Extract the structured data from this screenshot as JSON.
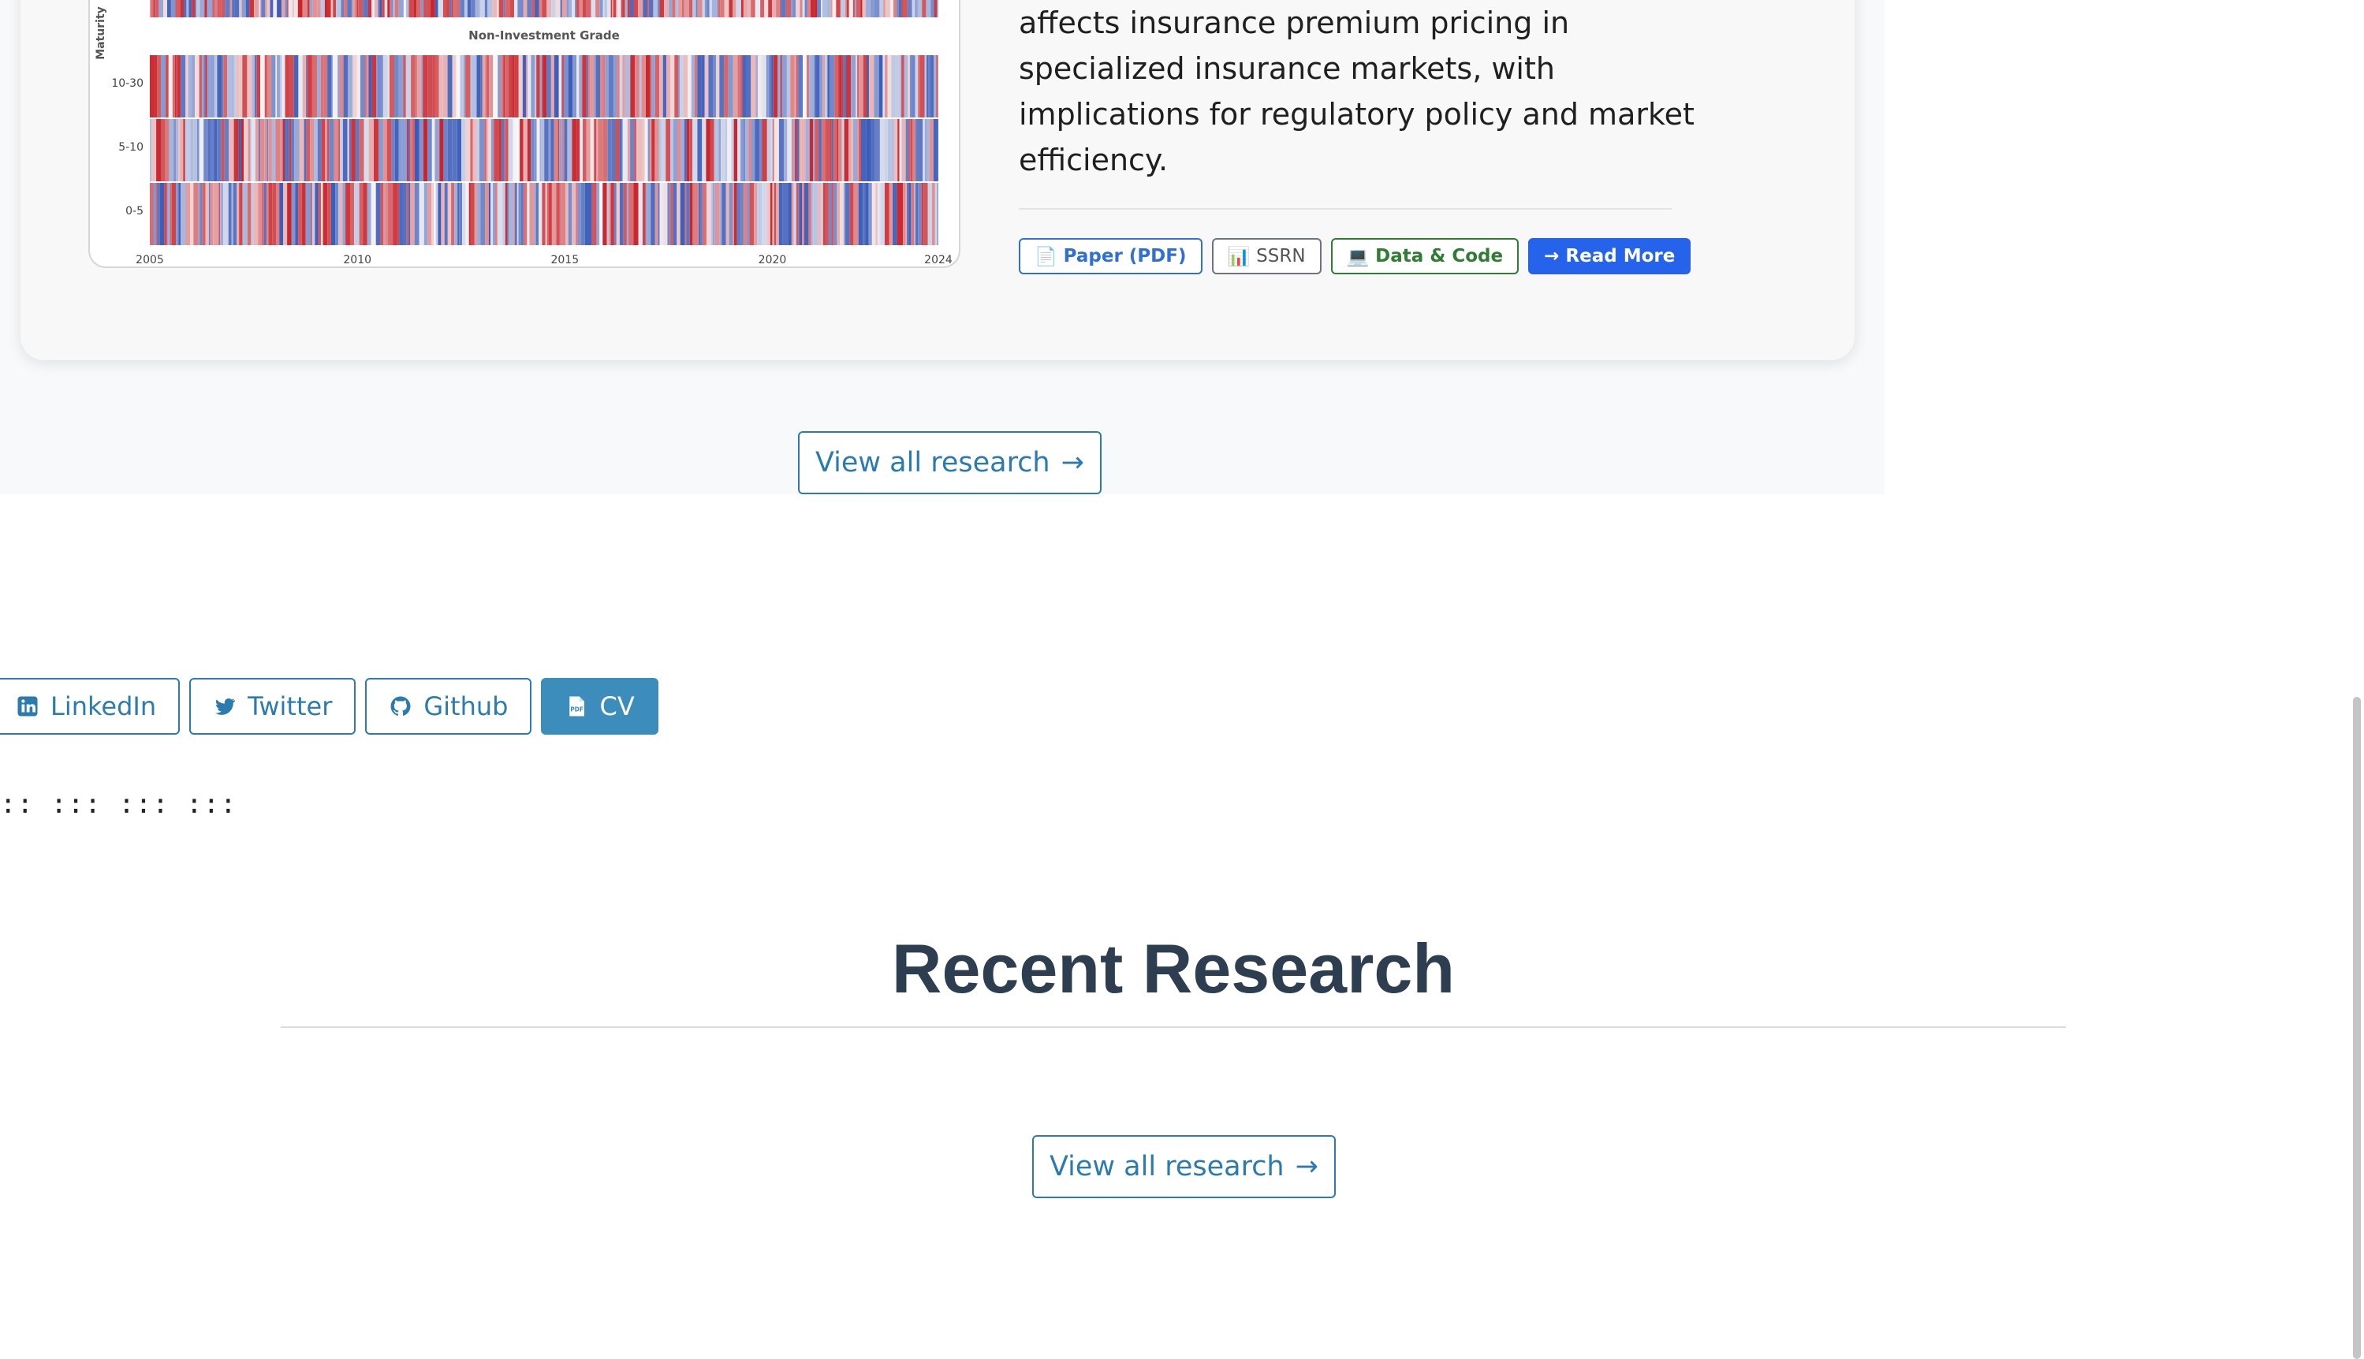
{
  "card": {
    "abstract": "affects insurance premium pricing in specialized insurance markets, with implications for regulatory policy and market efficiency.",
    "links": [
      {
        "label": "Paper (PDF)",
        "icon": "📄"
      },
      {
        "label": "SSRN",
        "icon": "📊"
      },
      {
        "label": "Data & Code",
        "icon": "💻"
      },
      {
        "label": "→ Read More",
        "icon": ""
      }
    ]
  },
  "view_all_top": {
    "label": "View all research",
    "arrow": "→"
  },
  "social": [
    {
      "label": "LinkedIn",
      "icon": "linkedin-icon"
    },
    {
      "label": "Twitter",
      "icon": "twitter-icon"
    },
    {
      "label": "Github",
      "icon": "github-icon"
    },
    {
      "label": "CV",
      "icon": "pdf-file-icon"
    }
  ],
  "separator": ":: ::: ::: :::",
  "recent": {
    "title": "Recent Research",
    "view_all": {
      "label": "View all research",
      "arrow": "→"
    }
  },
  "chart_data": {
    "type": "heatmap",
    "title": "Non-Investment Grade",
    "ylabel": "Maturity",
    "y_categories": [
      "10-30",
      "5-10",
      "0-5"
    ],
    "x_ticks": [
      "2005",
      "2010",
      "2015",
      "2020",
      "2024"
    ],
    "xlim": [
      2005,
      2024
    ],
    "colormap": {
      "negative": "#3b5bb8",
      "neutral": "#f7f7f7",
      "positive": "#c8242b"
    }
  }
}
